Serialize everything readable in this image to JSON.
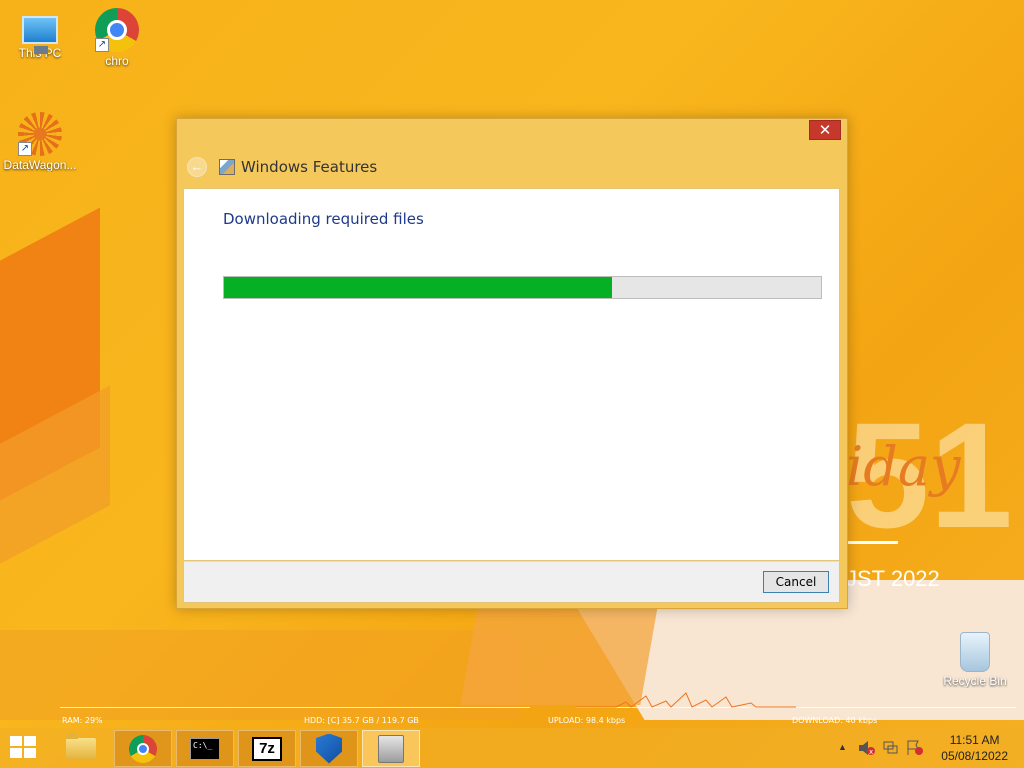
{
  "desktop": {
    "icons": [
      {
        "label": "This PC"
      },
      {
        "label": "chro"
      },
      {
        "label": "DataWagon..."
      },
      {
        "label": "Recycle Bin"
      }
    ],
    "widget": {
      "day_partial": "iday",
      "month_partial": "JST 2022",
      "number_partial": "51"
    }
  },
  "dialog": {
    "title": "Windows Features",
    "close_label": "✕",
    "heading": "Downloading required files",
    "progress": 0.65,
    "cancel_label": "Cancel"
  },
  "meters": {
    "ram": "RAM: 29%",
    "hdd": "HDD: [C] 35.7 GB / 119.7 GB",
    "upload": "UPLOAD: 98.4 kbps",
    "download": "DOWNLOAD: 40 kbps"
  },
  "taskbar": {
    "apps": [
      {
        "name": "File Explorer"
      },
      {
        "name": "Google Chrome"
      },
      {
        "name": "Command Prompt"
      },
      {
        "name": "7-Zip"
      },
      {
        "name": "Windows Defender"
      },
      {
        "name": "Windows Features"
      }
    ],
    "cmd_text": "C:\\_",
    "sevenz_text": "7z",
    "tray_arrow": "▲",
    "time": "11:51 AM",
    "date": "05/08/12022"
  },
  "colors": {
    "progress_fill": "#06b025",
    "heading_text": "#1e3a8a",
    "close_button": "#c7382c"
  }
}
